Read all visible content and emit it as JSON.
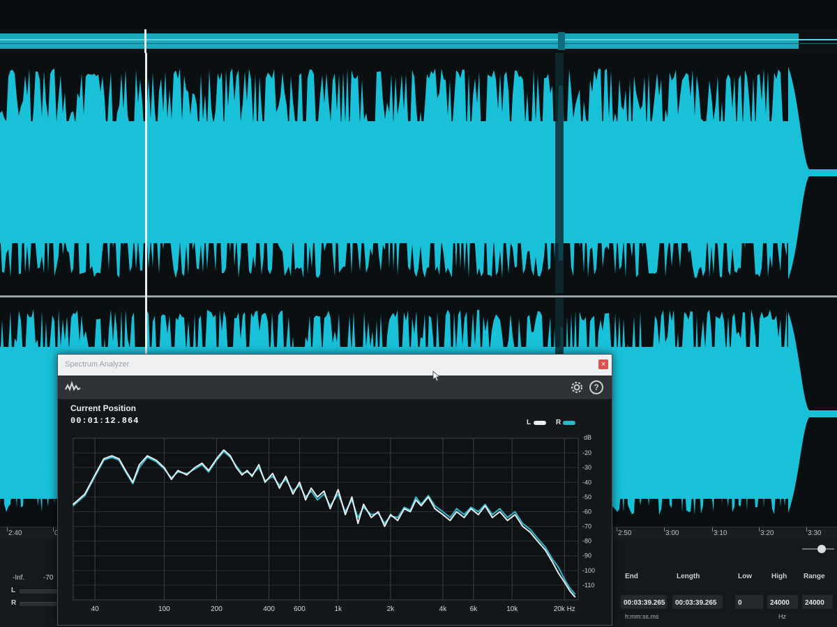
{
  "timeline": {
    "ticks": [
      {
        "label": "2:40",
        "at": 0.008
      },
      {
        "label": "0:50",
        "at": 0.063
      },
      {
        "label": "2:50",
        "at": 0.737
      },
      {
        "label": "3:00",
        "at": 0.793
      },
      {
        "label": "3:10",
        "at": 0.851
      },
      {
        "label": "3:20",
        "at": 0.907
      },
      {
        "label": "3:30",
        "at": 0.963
      }
    ]
  },
  "meters": {
    "scale_left": "-Inf.",
    "scale_right": "-70",
    "channel_left": "L",
    "channel_right": "R"
  },
  "selection": {
    "end_label": "End",
    "length_label": "Length",
    "end_value": "00:03:39.265",
    "length_value": "00:03:39.265",
    "time_unit": "h:mm:ss.ms",
    "low_label": "Low",
    "high_label": "High",
    "range_label": "Range",
    "low_value": "0",
    "high_value": "24000",
    "range_value": "24000",
    "freq_unit": "Hz"
  },
  "spectrum_window": {
    "title": "Spectrum Analyzer",
    "close_icon": "close-icon",
    "logo_icon": "waveform-logo-icon",
    "settings_icon": "gear-icon",
    "help_icon": "help-icon",
    "help_glyph": "?",
    "close_glyph": "×",
    "position_label": "Current Position",
    "position_value": "00:01:12.864",
    "legend_left": "L",
    "legend_right": "R",
    "color_left": "#e8eef2",
    "color_right": "#2fb8cc"
  },
  "chart_data": {
    "type": "line",
    "x_scale": "log",
    "x_unit": "Hz",
    "y_unit": "dB",
    "xlim": [
      30,
      24000
    ],
    "ylim": [
      -120,
      -10
    ],
    "x_ticks": [
      {
        "value": 40,
        "label": "40"
      },
      {
        "value": 100,
        "label": "100"
      },
      {
        "value": 200,
        "label": "200"
      },
      {
        "value": 400,
        "label": "400"
      },
      {
        "value": 600,
        "label": "600"
      },
      {
        "value": 1000,
        "label": "1k"
      },
      {
        "value": 2000,
        "label": "2k"
      },
      {
        "value": 4000,
        "label": "4k"
      },
      {
        "value": 6000,
        "label": "6k"
      },
      {
        "value": 10000,
        "label": "10k"
      },
      {
        "value": 20000,
        "label": "20k Hz"
      }
    ],
    "y_unit_label": "dB",
    "y_ticks": [
      {
        "value": -20,
        "label": "-20"
      },
      {
        "value": -30,
        "label": "-30"
      },
      {
        "value": -40,
        "label": "-40"
      },
      {
        "value": -50,
        "label": "-50"
      },
      {
        "value": -60,
        "label": "-60"
      },
      {
        "value": -70,
        "label": "-70"
      },
      {
        "value": -80,
        "label": "-80"
      },
      {
        "value": -90,
        "label": "-90"
      },
      {
        "value": -100,
        "label": "-100"
      },
      {
        "value": -110,
        "label": "-110"
      }
    ],
    "grid": true,
    "legend": "top-right",
    "series": [
      {
        "name": "L",
        "color": "#e8eef2",
        "x": [
          30,
          35,
          40,
          45,
          50,
          55,
          60,
          66,
          72,
          80,
          90,
          100,
          110,
          120,
          135,
          150,
          165,
          180,
          200,
          220,
          240,
          260,
          280,
          300,
          320,
          350,
          380,
          420,
          460,
          500,
          550,
          600,
          650,
          700,
          760,
          830,
          900,
          1000,
          1100,
          1200,
          1300,
          1400,
          1550,
          1700,
          1850,
          2000,
          2200,
          2400,
          2600,
          2800,
          3000,
          3300,
          3600,
          4000,
          4400,
          4800,
          5300,
          5800,
          6400,
          7000,
          7700,
          8500,
          9400,
          10400,
          11500,
          12700,
          14000,
          15500,
          17000,
          18500,
          20000,
          21500,
          23000
        ],
        "y": [
          -55,
          -48,
          -35,
          -24,
          -22,
          -24,
          -32,
          -40,
          -28,
          -22,
          -25,
          -30,
          -38,
          -32,
          -35,
          -30,
          -27,
          -32,
          -24,
          -18,
          -22,
          -30,
          -35,
          -32,
          -36,
          -28,
          -40,
          -34,
          -44,
          -36,
          -48,
          -40,
          -52,
          -44,
          -50,
          -46,
          -58,
          -45,
          -62,
          -50,
          -68,
          -55,
          -64,
          -60,
          -70,
          -62,
          -66,
          -58,
          -60,
          -52,
          -56,
          -50,
          -58,
          -62,
          -66,
          -60,
          -64,
          -58,
          -62,
          -56,
          -64,
          -60,
          -66,
          -62,
          -70,
          -74,
          -80,
          -86,
          -94,
          -102,
          -108,
          -114,
          -118
        ]
      },
      {
        "name": "R",
        "color": "#2fb8cc",
        "x": [
          30,
          35,
          40,
          45,
          50,
          55,
          60,
          66,
          72,
          80,
          90,
          100,
          110,
          120,
          135,
          150,
          165,
          180,
          200,
          220,
          240,
          260,
          280,
          300,
          320,
          350,
          380,
          420,
          460,
          500,
          550,
          600,
          650,
          700,
          760,
          830,
          900,
          1000,
          1100,
          1200,
          1300,
          1400,
          1550,
          1700,
          1850,
          2000,
          2200,
          2400,
          2600,
          2800,
          3000,
          3300,
          3600,
          4000,
          4400,
          4800,
          5300,
          5800,
          6400,
          7000,
          7700,
          8500,
          9400,
          10400,
          11500,
          12700,
          14000,
          15500,
          17000,
          18500,
          20000,
          21500,
          23000
        ],
        "y": [
          -56,
          -49,
          -36,
          -25,
          -23,
          -25,
          -33,
          -41,
          -30,
          -23,
          -26,
          -31,
          -37,
          -33,
          -34,
          -31,
          -28,
          -33,
          -25,
          -19,
          -23,
          -29,
          -34,
          -33,
          -35,
          -30,
          -39,
          -36,
          -42,
          -38,
          -46,
          -42,
          -50,
          -46,
          -52,
          -48,
          -56,
          -48,
          -60,
          -52,
          -64,
          -57,
          -62,
          -61,
          -68,
          -63,
          -64,
          -57,
          -59,
          -50,
          -55,
          -49,
          -56,
          -60,
          -64,
          -58,
          -62,
          -57,
          -60,
          -55,
          -62,
          -58,
          -64,
          -60,
          -68,
          -72,
          -78,
          -84,
          -92,
          -98,
          -106,
          -112,
          -116
        ]
      }
    ]
  }
}
